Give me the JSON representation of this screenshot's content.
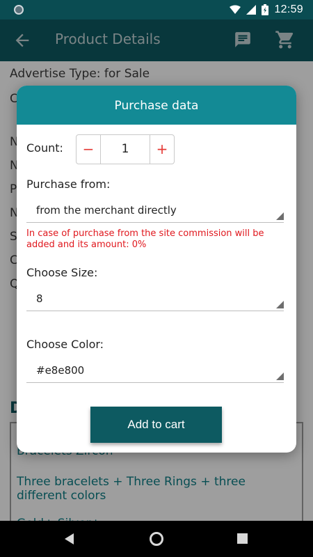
{
  "status_bar": {
    "time": "12:59"
  },
  "app_bar": {
    "title": "Product Details"
  },
  "background": {
    "advertise_type": "Advertise Type: for Sale",
    "partial_lines": [
      "C",
      "N",
      "N",
      "P",
      "N",
      "S",
      "C",
      "Q"
    ],
    "section_initial": "D",
    "box_lines": [
      "Bracelets Zircon",
      "Three bracelets + Three Rings + three",
      "different colors",
      "Gold+ Silver+ ..."
    ]
  },
  "dialog": {
    "title": "Purchase data",
    "count_label": "Count:",
    "count_value": "1",
    "minus_label": "−",
    "plus_label": "+",
    "purchase_from_label": "Purchase from:",
    "purchase_from_value": "from the merchant directly",
    "commission_note": "In case of purchase from the site commission will be added and its amount: 0%",
    "size_label": "Choose Size:",
    "size_value": "8",
    "color_label": "Choose Color:",
    "color_value": "#e8e800",
    "add_to_cart_label": "Add to cart"
  },
  "colors": {
    "primary": "#0d5a61",
    "dialog_header": "#138a95",
    "warning_text": "#e0171d"
  }
}
